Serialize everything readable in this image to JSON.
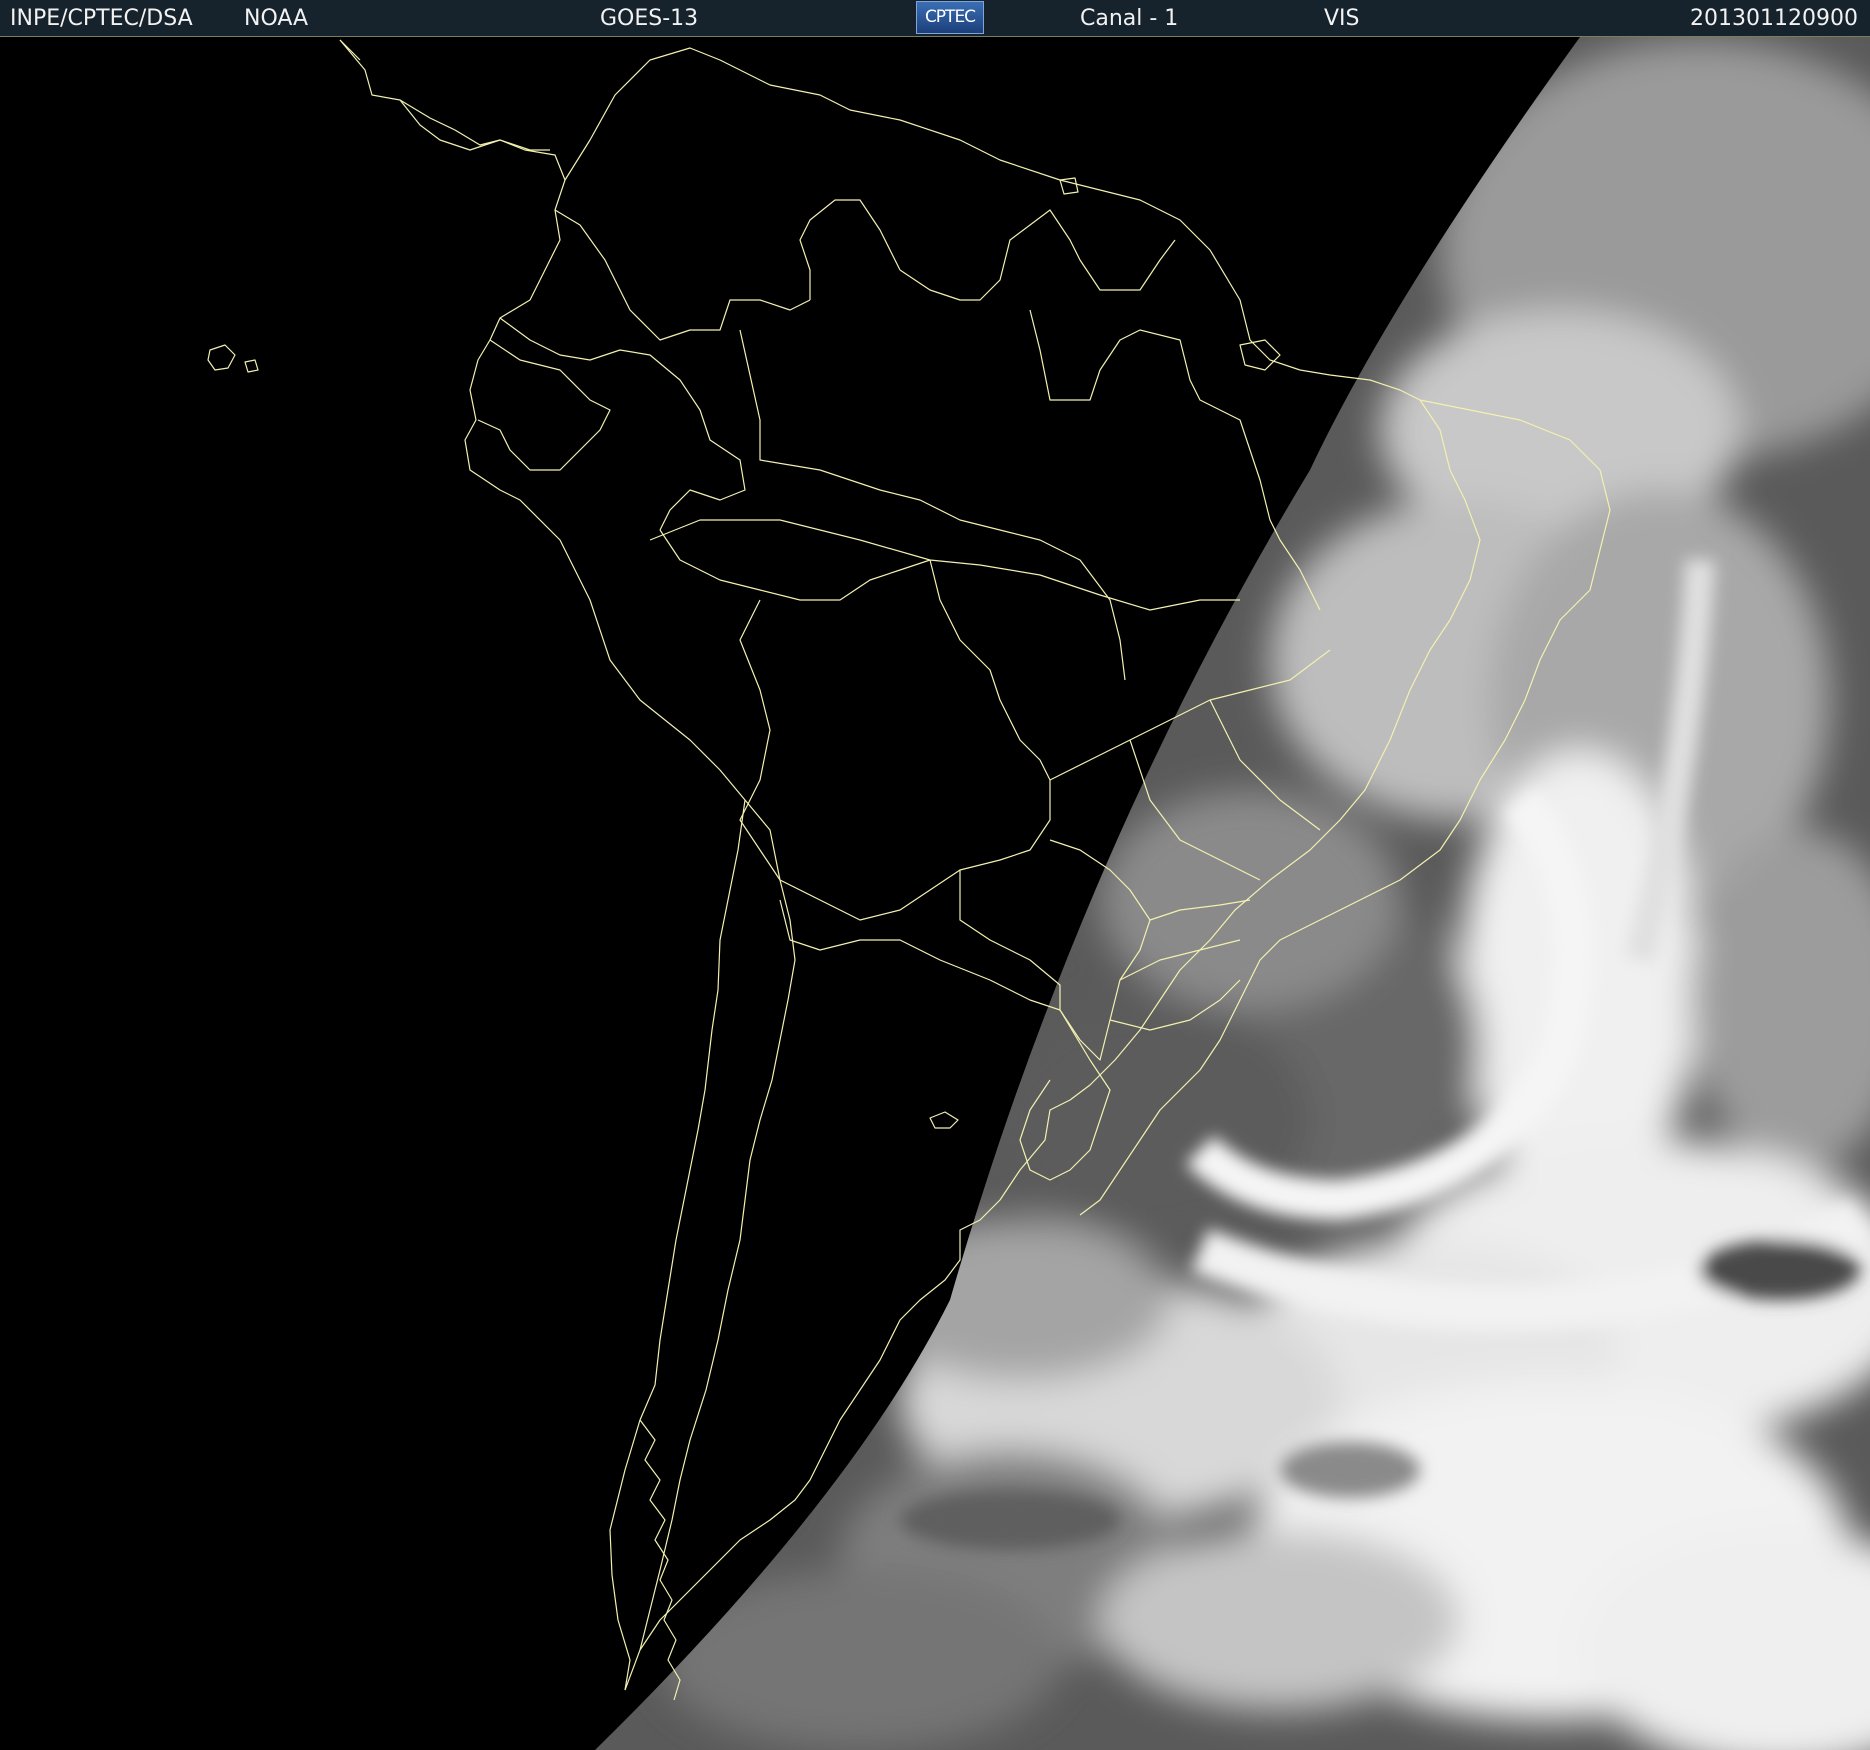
{
  "header": {
    "agency": "INPE/CPTEC/DSA",
    "source": "NOAA",
    "satellite": "GOES-13",
    "logo_text": "CPTEC",
    "channel": "Canal - 1",
    "band": "VIS",
    "timestamp": "201301120900"
  },
  "map": {
    "background_color": "#000000",
    "border_color": "#f2f0b0",
    "cloud_shades": [
      "#2b2b2b",
      "#4e4e4e",
      "#757575",
      "#a3a3a3",
      "#d2d2d2",
      "#f0f0f0"
    ]
  }
}
